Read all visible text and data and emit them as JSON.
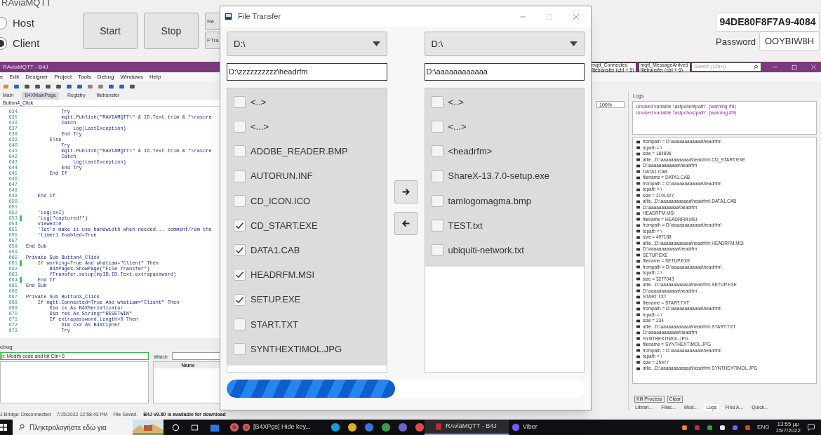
{
  "app_window": {
    "title": "RAviaMQTT",
    "radios": [
      {
        "label": "Host",
        "selected": false
      },
      {
        "label": "Client",
        "selected": true
      }
    ],
    "buttons": [
      "Start",
      "Stop"
    ],
    "side_buttons": [
      "Re",
      "FTra"
    ],
    "device_id": "94DE80F8F7A9-4084",
    "password_label": "Password",
    "password": "OOYBIW8H"
  },
  "ide": {
    "title": "RAviaMQTT - B4J",
    "menu": [
      "e",
      "Edit",
      "Designer",
      "Project",
      "Tools",
      "Debug",
      "Windows",
      "Help"
    ],
    "tabs": [
      {
        "label": "Main",
        "selected": false
      },
      {
        "label": "B4XMainPage",
        "selected": true
      },
      {
        "label": "Registry",
        "selected": false
      },
      {
        "label": "filetransfer",
        "selected": false
      }
    ],
    "nav": [
      {
        "name": "mqtt_Connected",
        "module": "filetransfer (ctrl + 5)"
      },
      {
        "name": "mqtt_MessageArrived",
        "module": "filetransfer (ctrl + 6)"
      }
    ],
    "search": {
      "placeholder": "Search (Ctrl+I)"
    },
    "sub_label": "Button4_Click",
    "zoom": "100%",
    "code": [
      {
        "line": "634",
        "text": "            Try",
        "changed": false
      },
      {
        "line": "635",
        "text": "            mqtt.Publish(\"RAVIAMQTT\\\" & ID.Text.trim & \"\\rascre",
        "changed": false
      },
      {
        "line": "636",
        "text": "            Catch",
        "changed": false
      },
      {
        "line": "637",
        "text": "                Log(LastException)",
        "changed": false
      },
      {
        "line": "638",
        "text": "            End Try",
        "changed": false
      },
      {
        "line": "639",
        "text": "        Else",
        "changed": false
      },
      {
        "line": "640",
        "text": "            Try",
        "changed": false
      },
      {
        "line": "641",
        "text": "            mqtt.Publish(\"RAVIAMQTT\\\" & ID.Text.trim & \"\\rascre",
        "changed": false
      },
      {
        "line": "642",
        "text": "            Catch",
        "changed": false
      },
      {
        "line": "643",
        "text": "                Log(LastException)",
        "changed": false
      },
      {
        "line": "644",
        "text": "            End Try",
        "changed": false
      },
      {
        "line": "645",
        "text": "        End If",
        "changed": false
      },
      {
        "line": "646",
        "changed": false
      },
      {
        "line": "647",
        "changed": false
      },
      {
        "line": "648",
        "changed": false
      },
      {
        "line": "649",
        "text": "    End If",
        "changed": false
      },
      {
        "line": "650",
        "changed": false
      },
      {
        "line": "651",
        "changed": false
      },
      {
        "line": "652",
        "text": "    'Log(oxI)",
        "changed": false
      },
      {
        "line": "653",
        "text": "    'Log(\"captured!\")",
        "changed": true
      },
      {
        "line": "654",
        "text": "    viewed=0",
        "changed": false
      },
      {
        "line": "655",
        "text": "    'let's make it use bandwidth when needed... comment/rem the",
        "changed": false
      },
      {
        "line": "656",
        "text": "    'timer1.Enabled=True",
        "changed": false
      },
      {
        "line": "657",
        "changed": false
      },
      {
        "line": "658",
        "text": "End Sub",
        "changed": false
      },
      {
        "line": "659",
        "changed": false
      },
      {
        "line": "660",
        "text": "Private Sub Button4_Click",
        "changed": false
      },
      {
        "line": "661",
        "text": "    If working=True And whatiam=\"Client\" Then",
        "changed": true
      },
      {
        "line": "662",
        "text": "        B4XPages.ShowPage(\"File Transfer\")",
        "changed": false
      },
      {
        "line": "663",
        "text": "        fTransfer.setup(myID,ID.Text,extrapassword)",
        "changed": false
      },
      {
        "line": "664",
        "text": "    End If",
        "changed": true
      },
      {
        "line": "665",
        "text": "End Sub",
        "changed": false
      },
      {
        "line": "666",
        "changed": false
      },
      {
        "line": "667",
        "text": "Private Sub Button3_Click",
        "changed": false
      },
      {
        "line": "668",
        "text": "    If mqtt.Connected=True And whatiam=\"Client\" Then",
        "changed": false
      },
      {
        "line": "669",
        "text": "        Dim cx As B4XSerializator",
        "changed": false
      },
      {
        "line": "670",
        "text": "        Dim res As String=\"RESETWIN\"",
        "changed": false
      },
      {
        "line": "671",
        "text": "        If extrapassword.Length>0 Then",
        "changed": false
      },
      {
        "line": "672",
        "text": "            Dim cx2 As B4XCipher",
        "changed": false
      },
      {
        "line": "673",
        "text": "            Try",
        "changed": false
      }
    ]
  },
  "debug": {
    "title": "ebug",
    "tip": "p: Modify code and hit Ctrl+S",
    "watch_label": "Watch:",
    "column": "Name"
  },
  "status_bar": {
    "bridge": "J-Bridge: Disconnected",
    "time": "7/15/2022 12:58:43 PM",
    "message": "File Saved.",
    "update": "B4J v9.80 is available for download"
  },
  "logs": {
    "title": "Logs",
    "warnings": [
      "Unused variable 'lastpclientpath'. (warning #9)",
      "Unused variable 'lastpchostpath'. (warning #9)"
    ],
    "lines": [
      "frompath = D:\\aaaaaaaaaaaa\\headrfm\\",
      "topath = \\",
      "size = 184896",
      "afile...D:\\aaaaaaaaaaaa\\headrfm\\ CD_START.EXE",
      "D:\\aaaaaaaaaaaa\\headrfm",
      "DATA1.CAB",
      "filename = DATA1.CAB",
      "frompath = D:\\aaaaaaaaaaaa\\headrfm\\",
      "topath = \\",
      "size = 2101427",
      "afile...D:\\aaaaaaaaaaaa\\headrfm\\ DATA1.CAB",
      "D:\\aaaaaaaaaaaa\\headrfm",
      "HEADRFM.MSI",
      "filename = HEADRFM.MSI",
      "frompath = D:\\aaaaaaaaaaaa\\headrfm\\",
      "topath = \\",
      "size = 497188",
      "afile...D:\\aaaaaaaaaaaa\\headrfm\\ HEADRFM.MSI",
      "D:\\aaaaaaaaaaaa\\headrfm",
      "SETUP.EXE",
      "filename = SETUP.EXE",
      "frompath = D:\\aaaaaaaaaaaa\\headrfm\\",
      "topath = \\",
      "size = 3277043",
      "afile...D:\\aaaaaaaaaaaa\\headrfm\\ SETUP.EXE",
      "D:\\aaaaaaaaaaaa\\headrfm",
      "START.TXT",
      "filename = START.TXT",
      "frompath = D:\\aaaaaaaaaaaa\\headrfm\\",
      "topath = \\",
      "size = 234",
      "afile...D:\\aaaaaaaaaaaa\\headrfm\\ START.TXT",
      "D:\\aaaaaaaaaaaa\\headrfm",
      "SYNTHEXTIMOL.JPG",
      "filename = SYNTHEXTIMOL.JPG",
      "frompath = D:\\aaaaaaaaaaaa\\headrfm\\",
      "topath = \\",
      "size = 25977",
      "afile...D:\\aaaaaaaaaaaa\\headrfm\\ SYNTHEXTIMOL.JPG"
    ],
    "buttons": [
      "Kill Process",
      "Clear"
    ],
    "tabs": [
      {
        "label": "Librari...",
        "selected": false
      },
      {
        "label": "Files...",
        "selected": false
      },
      {
        "label": "Mod...",
        "selected": false
      },
      {
        "label": "Logs",
        "selected": true
      },
      {
        "label": "Find A...",
        "selected": false
      },
      {
        "label": "Quick...",
        "selected": false
      }
    ]
  },
  "file_transfer": {
    "title": "File Transfer",
    "left": {
      "drive": "D:\\",
      "path": "D:\\zzzzzzzzzz\\headrfm",
      "items": [
        {
          "name": "<..>",
          "checked": false
        },
        {
          "name": "<...>",
          "checked": false
        },
        {
          "name": "ADOBE_READER.BMP",
          "checked": false
        },
        {
          "name": "AUTORUN.INF",
          "checked": false
        },
        {
          "name": "CD_ICON.ICO",
          "checked": false
        },
        {
          "name": "CD_START.EXE",
          "checked": true
        },
        {
          "name": "DATA1.CAB",
          "checked": true
        },
        {
          "name": "HEADRFM.MSI",
          "checked": true
        },
        {
          "name": "SETUP.EXE",
          "checked": true
        },
        {
          "name": "START.TXT",
          "checked": false
        },
        {
          "name": "SYNTHEXTIMOL.JPG",
          "checked": false
        }
      ]
    },
    "right": {
      "drive": "D:\\",
      "path": "D:\\aaaaaaaaaaaa",
      "items": [
        {
          "name": "<..>",
          "checked": false
        },
        {
          "name": "<...>",
          "checked": false
        },
        {
          "name": "<headrfm>",
          "checked": false
        },
        {
          "name": "ShareX-13.7.0-setup.exe",
          "checked": false
        },
        {
          "name": "tamlogomagma.bmp",
          "checked": false
        },
        {
          "name": "TEST.txt",
          "checked": false
        },
        {
          "name": "ubiquiti-network.txt",
          "checked": false
        }
      ]
    },
    "progress": {
      "level": 0.47
    }
  },
  "taskbar": {
    "search_placeholder": "Πληκτρολογήστε εδώ για",
    "apps": [
      {
        "label": "[B4XPgs] Hide key...",
        "selected": false
      },
      {
        "label": "RAviaMQTT - B4J",
        "selected": true
      },
      {
        "label": "Viber",
        "selected": false
      }
    ],
    "language": "ENG",
    "time": "13:55 μμ",
    "date": "15/7/2022"
  }
}
